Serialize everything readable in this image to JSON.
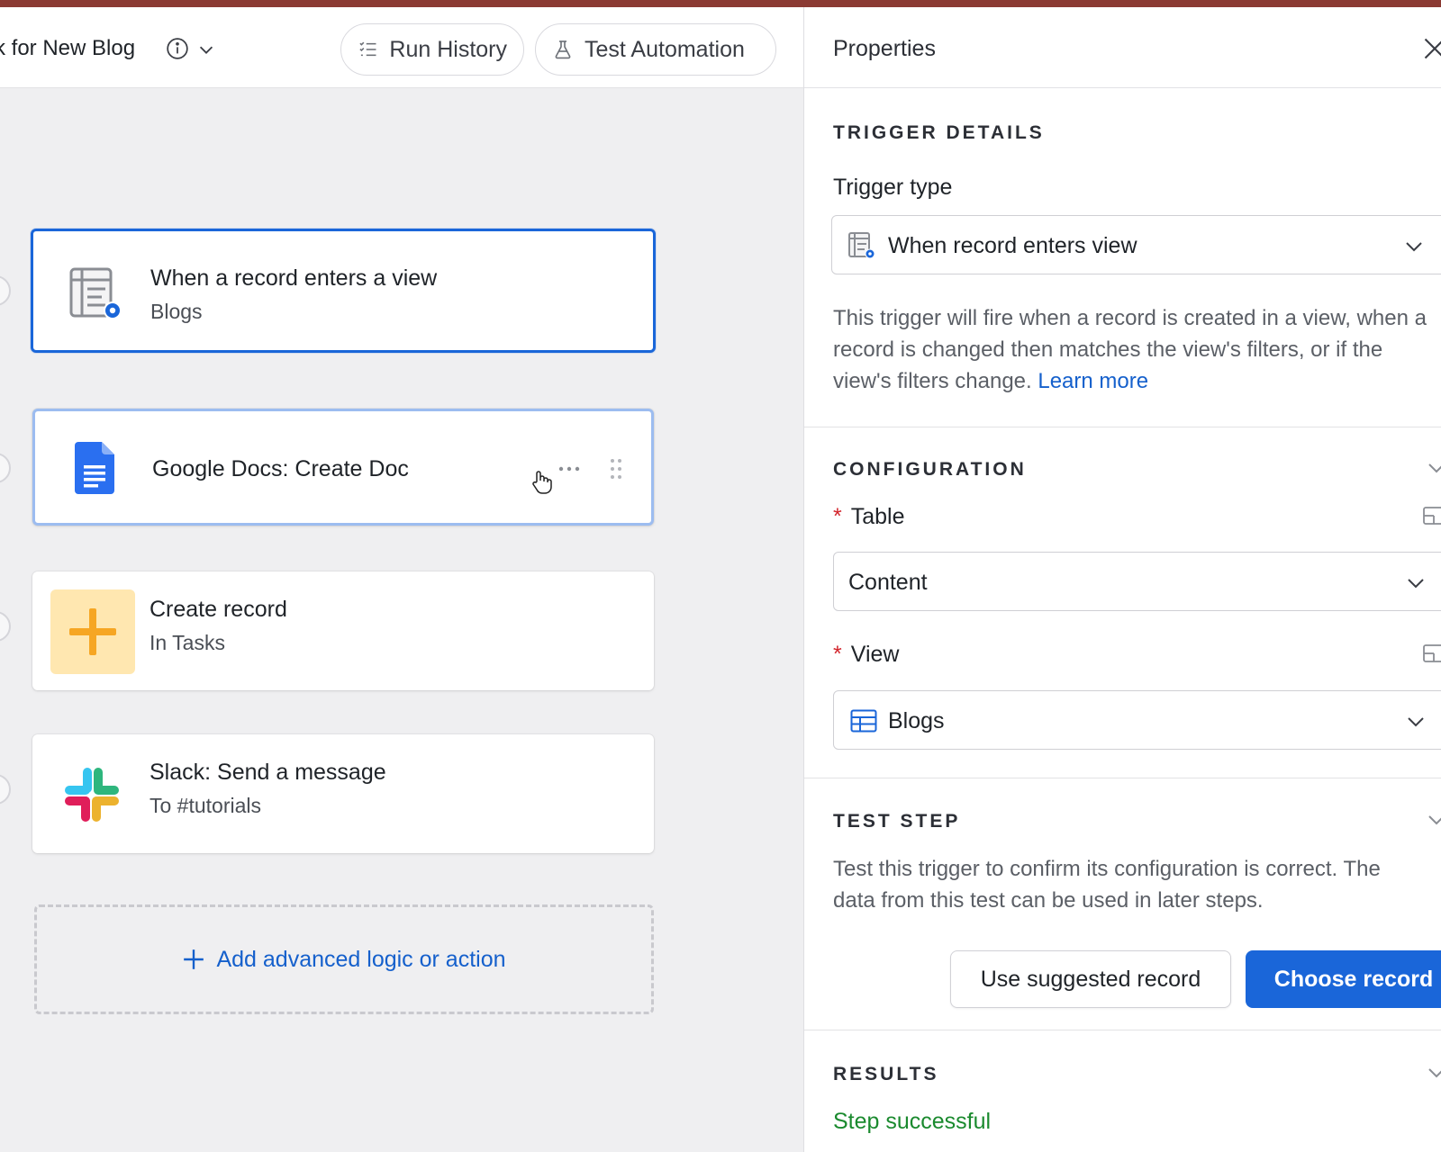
{
  "header": {
    "workflow_title": "k for New Blog",
    "run_history_label": "Run History",
    "test_automation_label": "Test Automation"
  },
  "steps": [
    {
      "title": "When a record enters a view",
      "subtitle": "Blogs",
      "icon": "table-eye-icon",
      "state": "selected"
    },
    {
      "title": "Google Docs: Create Doc",
      "subtitle": "",
      "icon": "google-docs-icon",
      "state": "hovered"
    },
    {
      "title": "Create record",
      "subtitle": "In Tasks",
      "icon": "plus-icon",
      "state": "normal"
    },
    {
      "title": "Slack: Send a message",
      "subtitle": "To #tutorials",
      "icon": "slack-icon",
      "state": "normal"
    }
  ],
  "add_action_label": "Add advanced logic or action",
  "properties": {
    "title": "Properties",
    "trigger_details": {
      "heading": "TRIGGER DETAILS",
      "trigger_type_label": "Trigger type",
      "trigger_type_value": "When record enters view",
      "description": "This trigger will fire when a record is created in a view, when a record is changed then matches the view's filters, or if the view's filters change.",
      "learn_more": "Learn more"
    },
    "configuration": {
      "heading": "CONFIGURATION",
      "required_mark": "*",
      "table_label": "Table",
      "table_value": "Content",
      "view_label": "View",
      "view_value": "Blogs"
    },
    "test_step": {
      "heading": "TEST STEP",
      "description": "Test this trigger to confirm its configuration is correct. The data from this test can be used in later steps.",
      "use_suggested_label": "Use suggested record",
      "choose_record_label": "Choose record"
    },
    "results": {
      "heading": "RESULTS",
      "status": "Step successful"
    }
  },
  "colors": {
    "accent": "#1a66d9",
    "success": "#1a8a2e",
    "required": "#d3262d",
    "top_stripe": "#8b3a33"
  }
}
